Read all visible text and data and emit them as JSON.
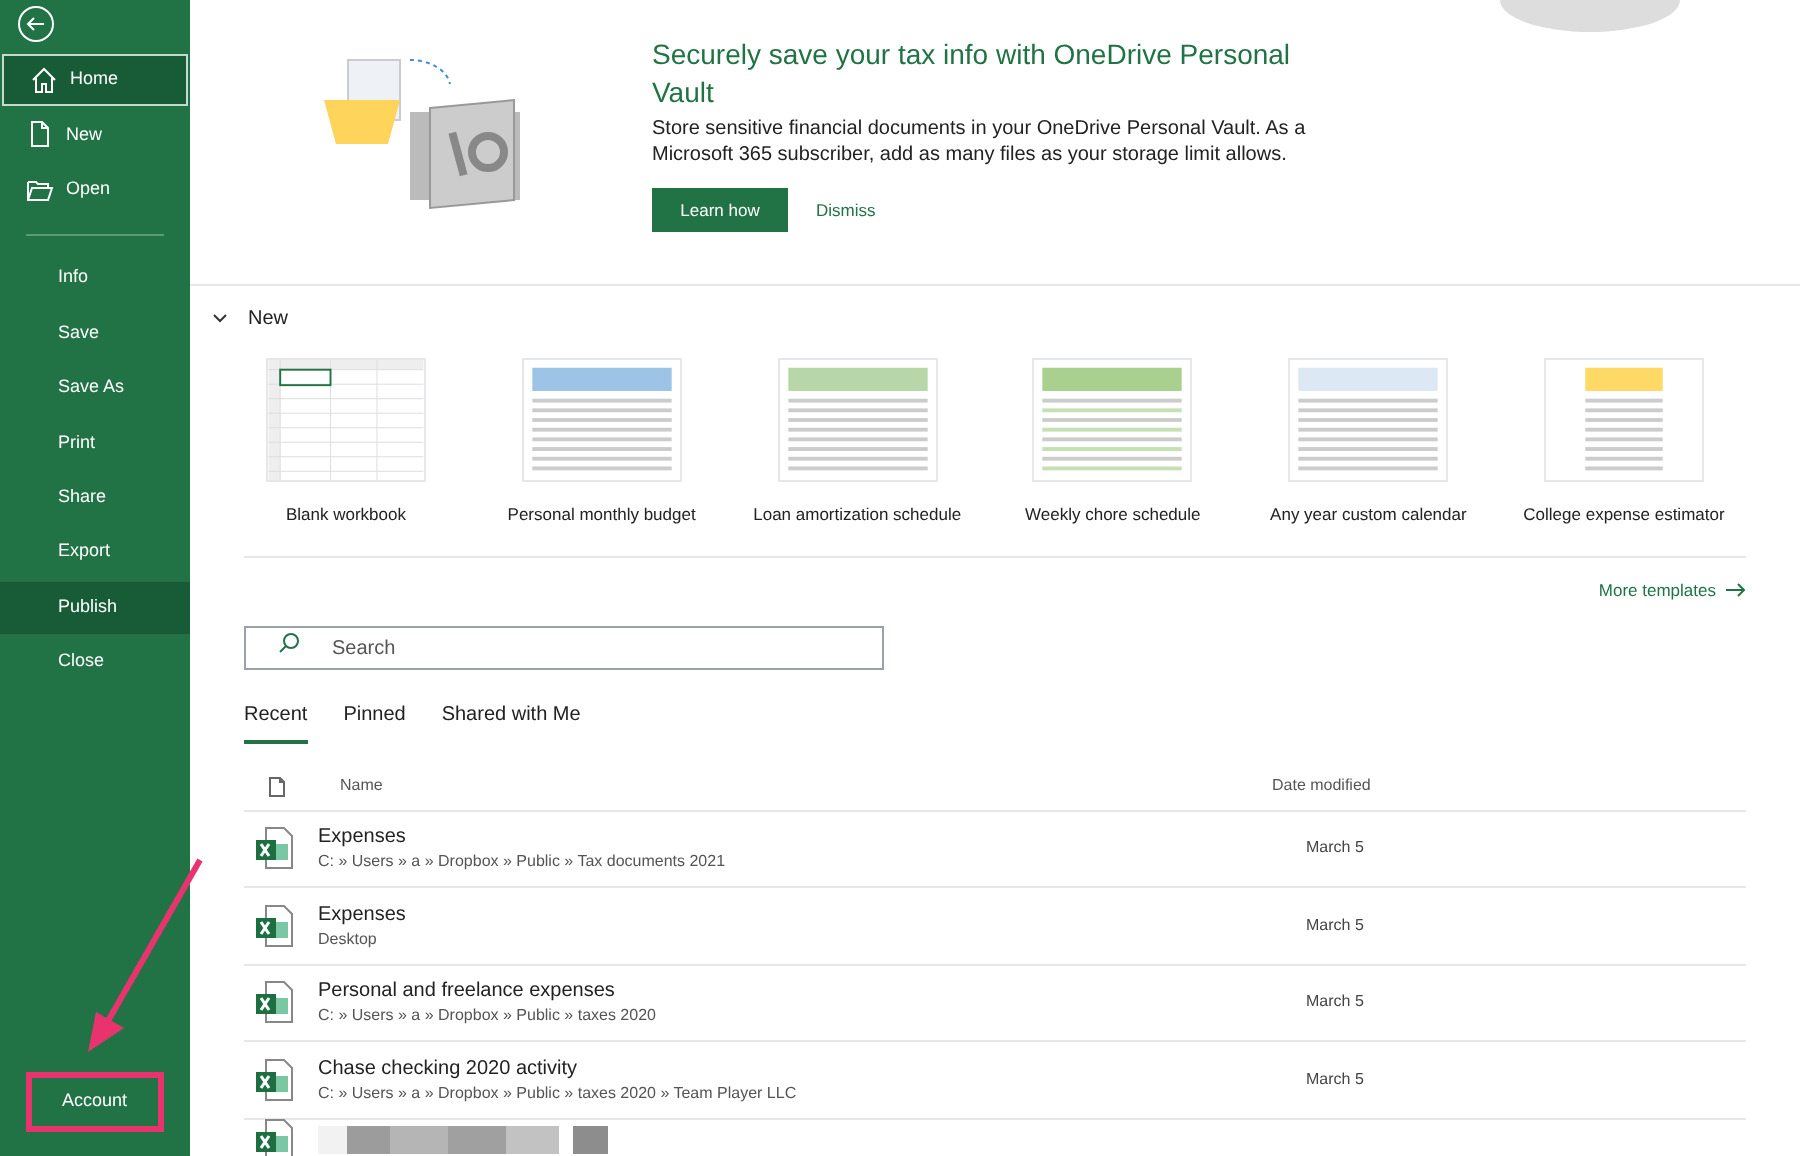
{
  "sidebar": {
    "items": [
      {
        "label": "Home",
        "kind": "icon",
        "selected": true,
        "hovered": false,
        "annotated": false
      },
      {
        "label": "New",
        "kind": "icon",
        "selected": false,
        "hovered": false,
        "annotated": false
      },
      {
        "label": "Open",
        "kind": "icon",
        "selected": false,
        "hovered": false,
        "annotated": false
      },
      {
        "label": "Info",
        "kind": "plain",
        "selected": false,
        "hovered": false,
        "annotated": false
      },
      {
        "label": "Save",
        "kind": "plain",
        "selected": false,
        "hovered": false,
        "annotated": false
      },
      {
        "label": "Save As",
        "kind": "plain",
        "selected": false,
        "hovered": false,
        "annotated": false
      },
      {
        "label": "Print",
        "kind": "plain",
        "selected": false,
        "hovered": false,
        "annotated": false
      },
      {
        "label": "Share",
        "kind": "plain",
        "selected": false,
        "hovered": false,
        "annotated": false
      },
      {
        "label": "Export",
        "kind": "plain",
        "selected": false,
        "hovered": false,
        "annotated": false
      },
      {
        "label": "Publish",
        "kind": "plain",
        "selected": false,
        "hovered": true,
        "annotated": false
      },
      {
        "label": "Close",
        "kind": "plain",
        "selected": false,
        "hovered": false,
        "annotated": false
      }
    ],
    "bottom_items": [
      {
        "label": "Account",
        "selected": false,
        "annotated": true
      }
    ]
  },
  "banner": {
    "title": "Securely save your tax info with OneDrive Personal Vault",
    "body": "Store sensitive financial documents in your OneDrive Personal Vault. As a Microsoft 365 subscriber, add as many files as your storage limit allows.",
    "primary_button": "Learn how",
    "secondary_button": "Dismiss"
  },
  "new_section": {
    "title": "New",
    "expanded": true,
    "templates": [
      {
        "label": "Blank workbook",
        "kind": "blank"
      },
      {
        "label": "Personal monthly budget",
        "kind": "budget"
      },
      {
        "label": "Loan amortization schedule",
        "kind": "loan"
      },
      {
        "label": "Weekly chore schedule",
        "kind": "chore"
      },
      {
        "label": "Any year custom calendar",
        "kind": "calendar"
      },
      {
        "label": "College expense estimator",
        "kind": "college"
      }
    ],
    "more_link": "More templates"
  },
  "search": {
    "placeholder": "Search"
  },
  "tabs": [
    {
      "label": "Recent",
      "selected": true
    },
    {
      "label": "Pinned",
      "selected": false
    },
    {
      "label": "Shared with Me",
      "selected": false
    }
  ],
  "file_table": {
    "columns": [
      "Name",
      "Date modified"
    ],
    "rows": [
      {
        "name": "Expenses",
        "path": "C: » Users » a » Dropbox » Public » Tax documents 2021",
        "date": "March 5",
        "redacted": false
      },
      {
        "name": "Expenses",
        "path": "Desktop",
        "date": "March 5",
        "redacted": false
      },
      {
        "name": "Personal and freelance expenses",
        "path": "C: » Users » a » Dropbox » Public » taxes 2020",
        "date": "March 5",
        "redacted": false
      },
      {
        "name": "Chase checking 2020 activity",
        "path": "C: » Users » a » Dropbox » Public » taxes 2020 » Team Player LLC",
        "date": "March 5",
        "redacted": false
      },
      {
        "redacted": true
      }
    ]
  }
}
